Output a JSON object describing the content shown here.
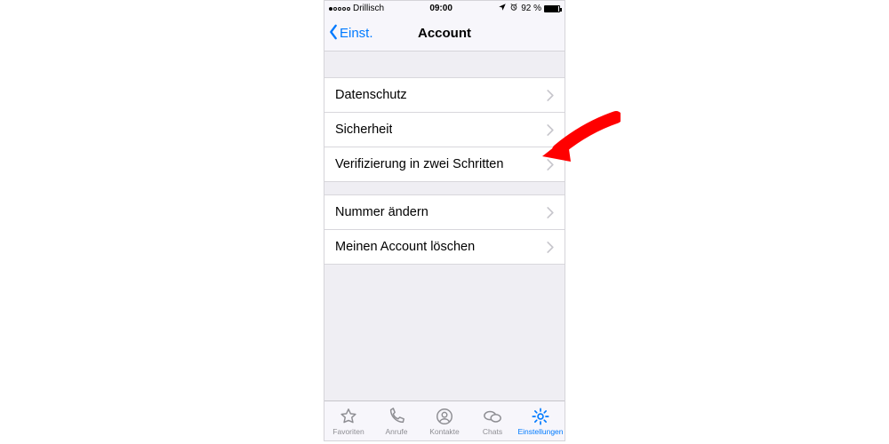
{
  "status": {
    "carrier": "Drillisch",
    "time": "09:00",
    "battery_text": "92 %"
  },
  "nav": {
    "back_label": "Einst.",
    "title": "Account"
  },
  "groups": [
    {
      "rows": [
        {
          "label": "Datenschutz"
        },
        {
          "label": "Sicherheit"
        },
        {
          "label": "Verifizierung in zwei Schritten"
        }
      ]
    },
    {
      "rows": [
        {
          "label": "Nummer ändern"
        },
        {
          "label": "Meinen Account löschen"
        }
      ]
    }
  ],
  "tabs": [
    {
      "name": "favoriten",
      "label": "Favoriten",
      "icon": "star-icon",
      "active": false
    },
    {
      "name": "anrufe",
      "label": "Anrufe",
      "icon": "phone-icon",
      "active": false
    },
    {
      "name": "kontakte",
      "label": "Kontakte",
      "icon": "contact-icon",
      "active": false
    },
    {
      "name": "chats",
      "label": "Chats",
      "icon": "chat-icon",
      "active": false
    },
    {
      "name": "einstellungen",
      "label": "Einstellungen",
      "icon": "gear-icon",
      "active": true
    }
  ],
  "annotation": {
    "type": "arrow",
    "color": "#ff0000"
  }
}
